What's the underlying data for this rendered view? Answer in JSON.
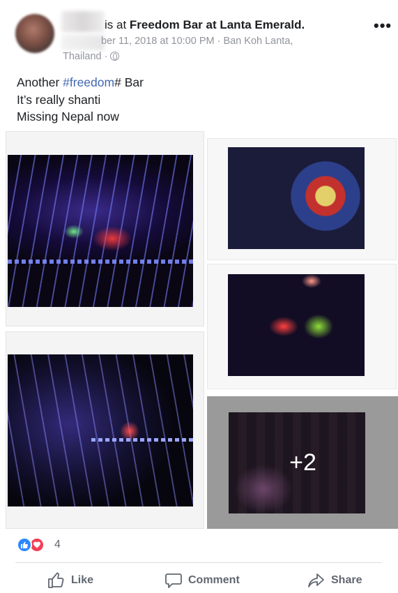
{
  "post": {
    "headline_prefix": "is at",
    "place": "Freedom Bar at Lanta Emerald.",
    "date_fragment": "ber 11, 2018 at 10:00 PM · Ban Koh Lanta,",
    "location_line": "Thailand ·",
    "more_label": "•••",
    "text_line1_prefix": "Another ",
    "hashtag": "#freedom",
    "text_line1_suffix": "# Bar",
    "text_line2": "It’s really shanti",
    "text_line3": "Missing Nepal now"
  },
  "photos": {
    "more_count": "+2"
  },
  "reactions": {
    "count": "4",
    "like_color": "#2d88ff",
    "love_color": "#f33e58"
  },
  "actions": {
    "like": "Like",
    "comment": "Comment",
    "share": "Share"
  },
  "colors": {
    "hashtag": "#4267b2",
    "meta_text": "#90949c",
    "action_text": "#606770"
  },
  "icons": [
    "more-options-icon",
    "globe-icon",
    "like-reaction-icon",
    "love-reaction-icon",
    "thumbs-up-icon",
    "comment-icon",
    "share-icon"
  ]
}
